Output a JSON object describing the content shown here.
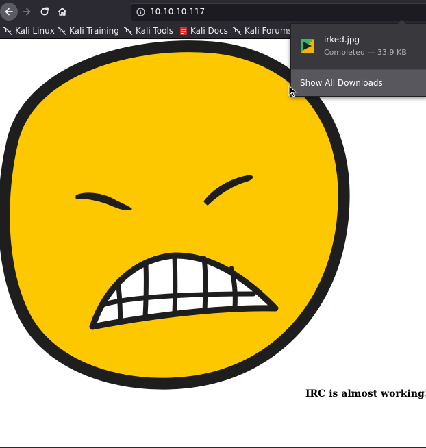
{
  "browser": {
    "url": "10.10.10.117",
    "nav": {
      "back_icon": "back-arrow-icon",
      "forward_icon": "forward-arrow-icon",
      "reload_icon": "reload-icon",
      "home_icon": "home-icon"
    }
  },
  "bookmarks": [
    {
      "label": "Kali Linux",
      "icon": "kali-dragon-icon"
    },
    {
      "label": "Kali Training",
      "icon": "kali-dragon-icon"
    },
    {
      "label": "Kali Tools",
      "icon": "kali-dragon-icon"
    },
    {
      "label": "Kali Docs",
      "icon": "kali-docs-icon"
    },
    {
      "label": "Kali Forums",
      "icon": "kali-dragon-icon"
    }
  ],
  "downloads": {
    "items": [
      {
        "filename": "irked.jpg",
        "status": "Completed — 33.9 KB",
        "icon": "image-file-icon"
      }
    ],
    "show_all_label": "Show All Downloads"
  },
  "page": {
    "message": "IRC is almost working!",
    "image": "angry-face-emoji",
    "colors": {
      "face": "#fdc800",
      "outline": "#1e1e1e",
      "teeth": "#ffffff"
    }
  }
}
